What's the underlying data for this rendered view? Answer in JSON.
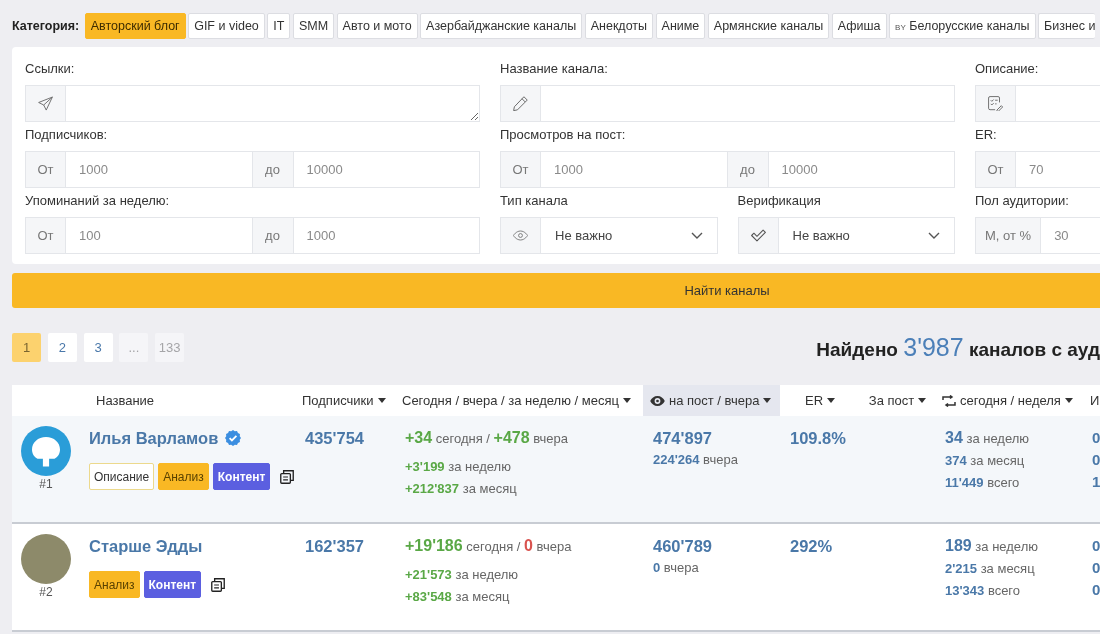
{
  "categories": {
    "label": "Категория:",
    "items": [
      {
        "label": "Авторский блог",
        "selected": true
      },
      {
        "label": "GIF и video",
        "selected": false
      },
      {
        "label": "IT",
        "selected": false
      },
      {
        "label": "SMM",
        "selected": false
      },
      {
        "label": "Авто и мото",
        "selected": false
      },
      {
        "label": "Азербайджанские каналы",
        "selected": false
      },
      {
        "label": "Анекдоты",
        "selected": false
      },
      {
        "label": "Аниме",
        "selected": false
      },
      {
        "label": "Армянские каналы",
        "selected": false
      },
      {
        "label": "Афиша",
        "selected": false
      },
      {
        "label": "Белорусские каналы",
        "prefix": "BY",
        "selected": false
      },
      {
        "label": "Бизнес и",
        "selected": false
      }
    ]
  },
  "filters": [
    {
      "kind": "textarea",
      "label": "Ссылки:"
    },
    {
      "kind": "text",
      "label": "Название канала:"
    },
    {
      "kind": "text",
      "label": "Описание:"
    },
    {
      "kind": "range",
      "label": "Подписчиков:",
      "from": {
        "prefix": "От",
        "placeholder": "1000"
      },
      "to": {
        "prefix": "до",
        "placeholder": "10000"
      }
    },
    {
      "kind": "range",
      "label": "Просмотров на пост:",
      "from": {
        "prefix": "От",
        "placeholder": "1000"
      },
      "to": {
        "prefix": "до",
        "placeholder": "10000"
      }
    },
    {
      "kind": "range",
      "label": "ER:",
      "from": {
        "prefix": "От",
        "placeholder": "70"
      }
    },
    {
      "kind": "range",
      "label": "Упоминаний за неделю:",
      "from": {
        "prefix": "От",
        "placeholder": "100"
      },
      "to": {
        "prefix": "до",
        "placeholder": "1000"
      }
    },
    {
      "kind": "select",
      "label": "Тип канала",
      "value": "Не важно"
    },
    {
      "kind": "select",
      "label": "Верификация",
      "value": "Не важно"
    },
    {
      "kind": "range",
      "label": "Пол аудитории:",
      "from": {
        "prefix": "М, от %",
        "placeholder": "30"
      }
    }
  ],
  "search_button": {
    "label": "Найти каналы"
  },
  "pagination": [
    {
      "label": "1",
      "selected": true,
      "disabled": false
    },
    {
      "label": "2",
      "selected": false,
      "disabled": false
    },
    {
      "label": "3",
      "selected": false,
      "disabled": false
    },
    {
      "label": "...",
      "selected": false,
      "disabled": true
    },
    {
      "label": "133",
      "selected": false,
      "disabled": true
    }
  ],
  "found": {
    "prefix": "Найдено",
    "count": "3'987",
    "suffix": "каналов с ауд"
  },
  "table": {
    "columns": [
      {
        "label": "Название",
        "kind": "plain",
        "selected": false
      },
      {
        "label": "Подписчики",
        "kind": "sort",
        "selected": false
      },
      {
        "label": "Сегодня / вчера / за неделю / месяц",
        "kind": "sort",
        "selected": false
      },
      {
        "label": "на пост / вчера",
        "kind": "views",
        "selected": true
      },
      {
        "label": "ER",
        "kind": "sort",
        "selected": false
      },
      {
        "label": "За пост",
        "kind": "sort",
        "selected": false
      },
      {
        "label": "сегодня / неделя",
        "kind": "reposts",
        "selected": false
      },
      {
        "label": "И",
        "kind": "plain",
        "selected": false
      }
    ],
    "rows": [
      {
        "rank": "#1",
        "avatar": {
          "kind": "logo"
        },
        "name": "Илья Варламов",
        "verified": true,
        "actions": [
          {
            "label": "Описание",
            "kind": "outline"
          },
          {
            "label": "Анализ",
            "kind": "warning"
          },
          {
            "label": "Контент",
            "kind": "primary"
          }
        ],
        "subscribers": "435'754",
        "growth": {
          "separator": "/",
          "lines": [
            [
              {
                "number": "+34",
                "period": "сегодня",
                "kind": "gain"
              },
              {
                "number": "+478",
                "period": "вчера",
                "kind": "gain"
              }
            ],
            [
              {
                "number": "+3'199",
                "period": "за неделю",
                "kind": "gain"
              }
            ],
            [
              {
                "number": "+212'837",
                "period": "за месяц",
                "kind": "gain"
              }
            ]
          ]
        },
        "views": {
          "number": "474'897",
          "yesterday": {
            "number": "224'264",
            "period": "вчера"
          }
        },
        "er": "109.8%",
        "reposts": [
          {
            "number": "34",
            "period": "за неделю"
          },
          {
            "number": "374",
            "period": "за месяц"
          },
          {
            "number": "11'449",
            "period": "всего"
          }
        ],
        "column_9": [
          "0",
          "0",
          "1"
        ]
      },
      {
        "rank": "#2",
        "avatar": {
          "kind": "photo"
        },
        "name": "Старше Эдды",
        "verified": false,
        "actions": [
          {
            "label": "Анализ",
            "kind": "warning"
          },
          {
            "label": "Контент",
            "kind": "primary"
          }
        ],
        "subscribers": "162'357",
        "growth": {
          "separator": "/",
          "lines": [
            [
              {
                "number": "+19'186",
                "period": "сегодня",
                "kind": "gain"
              },
              {
                "number": "0",
                "period": "вчера",
                "kind": "zero"
              }
            ],
            [
              {
                "number": "+21'573",
                "period": "за неделю",
                "kind": "gain"
              }
            ],
            [
              {
                "number": "+83'548",
                "period": "за месяц",
                "kind": "gain"
              }
            ]
          ]
        },
        "views": {
          "number": "460'789",
          "yesterday": {
            "number": "0",
            "period": "вчера"
          }
        },
        "er": "292%",
        "reposts": [
          {
            "number": "189",
            "period": "за неделю"
          },
          {
            "number": "2'215",
            "period": "за месяц"
          },
          {
            "number": "13'343",
            "period": "всего"
          }
        ],
        "column_9": [
          "0",
          "0",
          "0"
        ]
      }
    ]
  }
}
